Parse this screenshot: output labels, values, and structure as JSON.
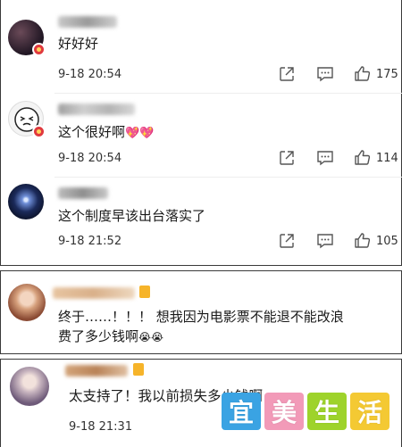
{
  "comments": [
    {
      "text": "好好好",
      "time": "9-18 20:54",
      "likes": "175"
    },
    {
      "text": "这个很好啊",
      "emoji": "💖💖",
      "time": "9-18 20:54",
      "likes": "114"
    },
    {
      "text": "这个制度早该出台落实了",
      "time": "9-18 21:52",
      "likes": "105"
    },
    {
      "text_line1": "终于……！！！ 想我因为电影票不能退不能改浪",
      "text_line2": "费了多少钱啊",
      "emoji": "😭😭"
    },
    {
      "text": "太支持了！我以前损失多少钱啊",
      "time": "9-18 21:31"
    }
  ],
  "watermark": {
    "chars": [
      "宜",
      "美",
      "生",
      "活"
    ]
  },
  "icons": {
    "share": "share-icon",
    "comment": "comment-icon",
    "like": "thumbs-up-icon"
  }
}
